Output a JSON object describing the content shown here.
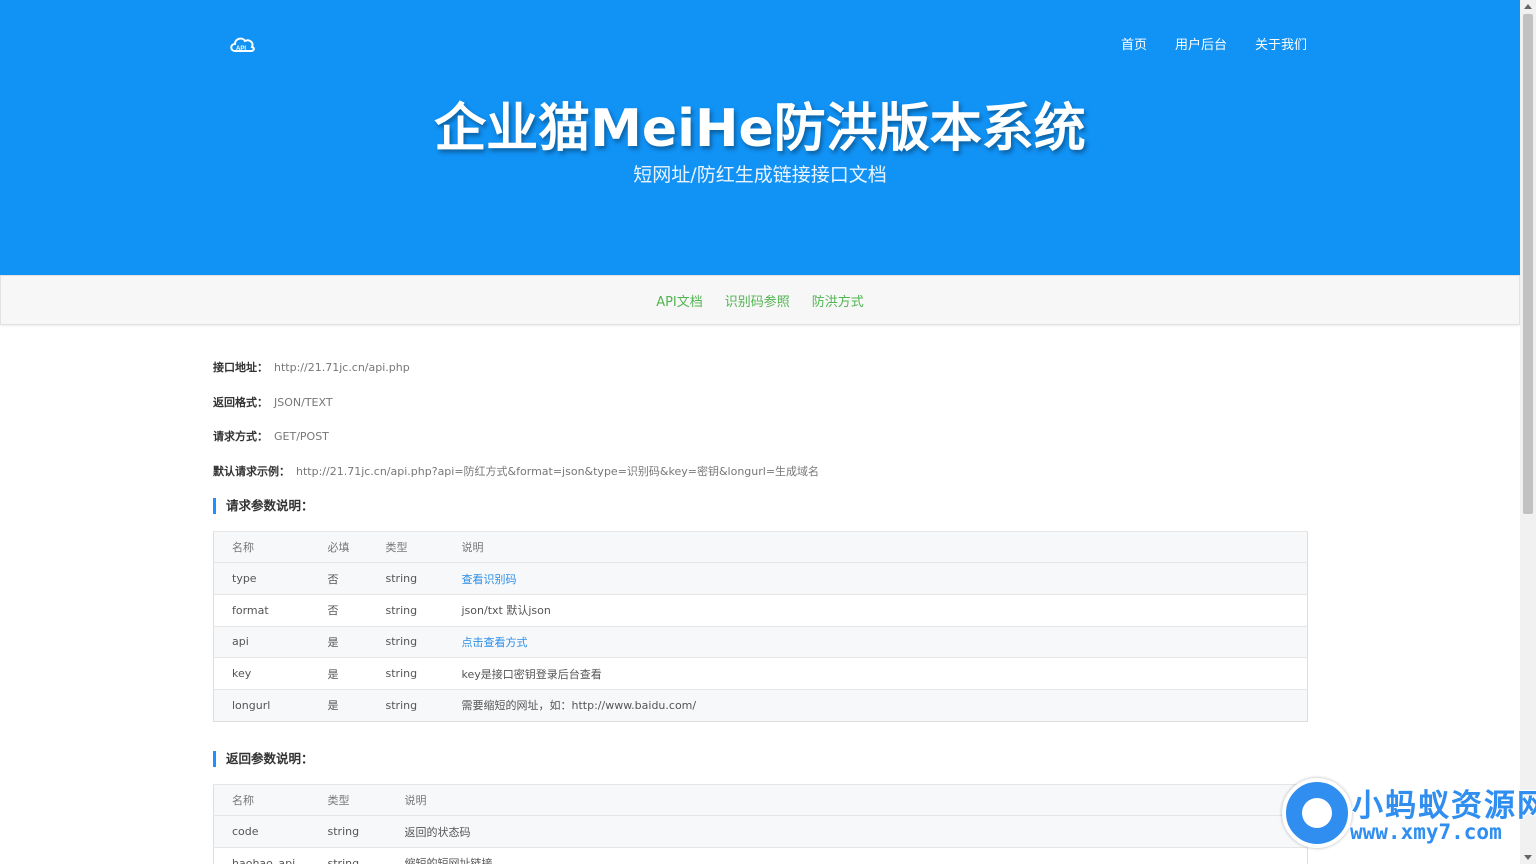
{
  "header": {
    "logo_icon": "cloud-api-icon",
    "nav": [
      "首页",
      "用户后台",
      "关于我们"
    ],
    "title": "企业猫MeiHe防洪版本系统",
    "subtitle": "短网址/防红生成链接接口文档"
  },
  "subnav": [
    "API文档",
    "识别码参照",
    "防洪方式"
  ],
  "info": [
    {
      "label": "接口地址：",
      "value": "http://21.71jc.cn/api.php"
    },
    {
      "label": "返回格式：",
      "value": "JSON/TEXT"
    },
    {
      "label": "请求方式：",
      "value": "GET/POST"
    },
    {
      "label": "默认请求示例：",
      "value": "http://21.71jc.cn/api.php?api=防红方式&format=json&type=识别码&key=密钥&longurl=生成域名"
    }
  ],
  "request_params": {
    "title": "请求参数说明：",
    "headers": [
      "名称",
      "必填",
      "类型",
      "说明"
    ],
    "rows": [
      [
        "type",
        "否",
        "string",
        "查看识别码"
      ],
      [
        "format",
        "否",
        "string",
        "json/txt 默认json"
      ],
      [
        "api",
        "是",
        "string",
        "点击查看方式"
      ],
      [
        "key",
        "是",
        "string",
        "key是接口密钥登录后台查看"
      ],
      [
        "longurl",
        "是",
        "string",
        "需要缩短的网址，如：http://www.baidu.com/"
      ]
    ]
  },
  "response_params": {
    "title": "返回参数说明：",
    "headers": [
      "名称",
      "类型",
      "说明"
    ],
    "rows": [
      [
        "code",
        "string",
        "返回的状态码"
      ],
      [
        "haohao_api",
        "string",
        "缩短的短网址链接"
      ]
    ]
  },
  "watermark": {
    "line1": "小蚂蚁资源网",
    "line2": "www.xmy7.com"
  }
}
